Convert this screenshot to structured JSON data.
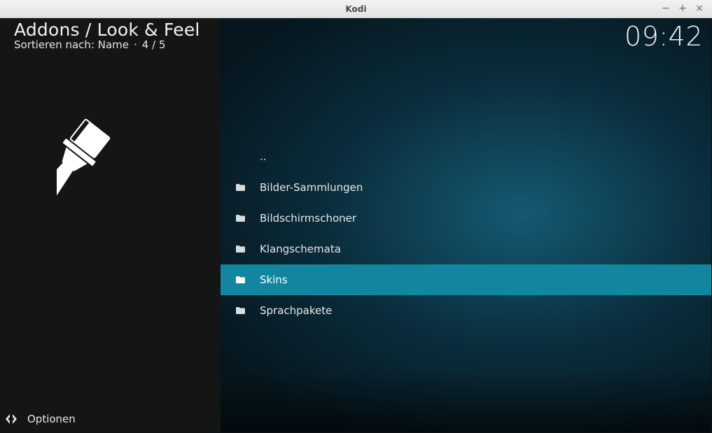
{
  "window": {
    "title": "Kodi",
    "controls": [
      "−",
      "+",
      "×"
    ]
  },
  "header": {
    "title": "Addons / Look & Feel",
    "sort_label": "Sortieren nach: Name",
    "separator": "·",
    "position": "4 / 5"
  },
  "clock": "09:42",
  "list": {
    "items": [
      {
        "label": "..",
        "has_icon": false
      },
      {
        "label": "Bilder-Sammlungen",
        "has_icon": true
      },
      {
        "label": "Bildschirmschoner",
        "has_icon": true
      },
      {
        "label": "Klangschemata",
        "has_icon": true
      },
      {
        "label": "Skins",
        "has_icon": true,
        "selected": true
      },
      {
        "label": "Sprachpakete",
        "has_icon": true
      }
    ]
  },
  "footer": {
    "options_label": "Optionen"
  },
  "icons": {
    "category": "paintbrush-icon",
    "folder": "folder-icon",
    "options": "options-arrows-icon"
  },
  "colors": {
    "accent": "#12869f",
    "left_panel": "#141515",
    "background": "#0d3c4e"
  }
}
